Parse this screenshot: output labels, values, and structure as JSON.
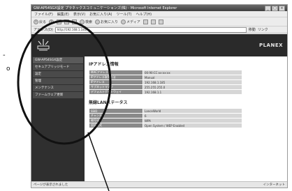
{
  "window": {
    "title": "GW-AP54SGX設定 プラネックスコミュニケーションズ(株) - Microsoft Internet Explorer",
    "buttons": [
      "_",
      "□",
      "×"
    ]
  },
  "menubar": [
    "ファイル(F)",
    "編集(E)",
    "表示(V)",
    "お気に入り(A)",
    "ツール(T)",
    "ヘルプ(H)"
  ],
  "toolbar": {
    "back_label": "戻る",
    "search_label": "検索",
    "favorites_label": "お気に入り",
    "media_label": "メディア"
  },
  "addressbar": {
    "label": "アドレス(D)",
    "value": "http://192.168.1.185/",
    "go_label": "移動",
    "links_label": "リンク"
  },
  "header": {
    "brand": "PLANEX"
  },
  "sidebar": {
    "items": [
      {
        "label": "GW-AP54SGX設定"
      },
      {
        "label": "セキュアブリッジモード"
      },
      {
        "label": "設定"
      },
      {
        "label": "管理"
      },
      {
        "label": "メンテナンス"
      },
      {
        "label": "ファームウェア更新"
      }
    ]
  },
  "ip_section": {
    "title": "IPアドレス情報",
    "rows": [
      {
        "key": "MACアドレス",
        "value": "00:90:CC:xx:xx:xx"
      },
      {
        "key": "IPアドレス取得方法",
        "value": "Manual"
      },
      {
        "key": "IPアドレス",
        "value": "192.168.1.185"
      },
      {
        "key": "サブネットマスク",
        "value": "255.255.255.0"
      },
      {
        "key": "デフォルトゲートウェイ",
        "value": "192.168.1.1"
      }
    ]
  },
  "lan_section": {
    "title": "無線LANステータス",
    "rows": [
      {
        "key": "SSID",
        "value": "LanceWorld"
      },
      {
        "key": "チャンネル",
        "value": "6"
      },
      {
        "key": "暗号化",
        "value": "WPA"
      },
      {
        "key": "認証方式",
        "value": "Open System / WEP Enabled"
      }
    ]
  },
  "statusbar": {
    "left": "ページが表示されました",
    "right": "インターネット"
  },
  "callout": {
    "label": "-",
    "marker": "o"
  }
}
